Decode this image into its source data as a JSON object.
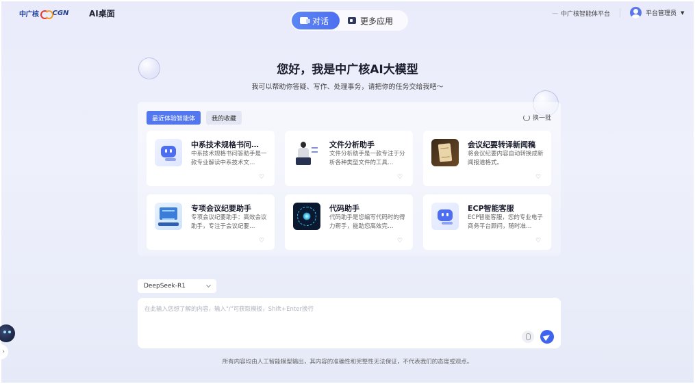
{
  "header": {
    "logo_cn": "中广核",
    "logo_en": "CGN",
    "app_title": "AI桌面",
    "mode_tabs": [
      {
        "label": "对话",
        "icon": "chat-icon",
        "active": true
      },
      {
        "label": "更多应用",
        "icon": "apps-icon",
        "active": false
      }
    ],
    "platform_link": "中广核智能体平台",
    "user_name": "平台管理员"
  },
  "hero": {
    "title": "您好，我是中广核AI大模型",
    "subtitle": "我可以帮助你答疑、写作、处理事务，请把你的任务交给我吧～"
  },
  "agents": {
    "tabs": [
      {
        "label": "最近体验智能体",
        "active": true
      },
      {
        "label": "我的收藏",
        "active": false
      }
    ],
    "refresh_label": "换一批",
    "cards": [
      {
        "title": "中系技术规格书问…",
        "desc": "中系技术规格书问答助手是一款专业解读中系技术文…",
        "icon": "robot-icon"
      },
      {
        "title": "文件分析助手",
        "desc": "文件分析助手是一款专注于分析各种类型文件的工具…",
        "icon": "person-laptop-icon"
      },
      {
        "title": "会议纪要转译新闻稿",
        "desc": "将会议纪要内容自动转换成新闻报道格式。",
        "icon": "scroll-icon"
      },
      {
        "title": "专项会议纪要助手",
        "desc": "专项会议纪要助手：高效会议助手，专注于会议纪要…",
        "icon": "meeting-icon"
      },
      {
        "title": "代码助手",
        "desc": "代码助手是您编写代码时的得力帮手，能助您高效完…",
        "icon": "code-orb-icon"
      },
      {
        "title": "ECP智能客服",
        "desc": "ECP智能客服，您的专业电子商务平台顾问，随时准…",
        "icon": "robot-icon"
      }
    ]
  },
  "composer": {
    "model": "DeepSeek-R1",
    "placeholder": "在此输入您想了解的内容，输入\"/\"可获取模板，Shift+Enter换行"
  },
  "footer": {
    "disclaimer": "所有内容均由人工智能模型输出，其内容的准确性和完整性无法保证，不代表我们的态度或观点。"
  },
  "colors": {
    "accent": "#4e6ff0",
    "background": "#eceefb"
  }
}
